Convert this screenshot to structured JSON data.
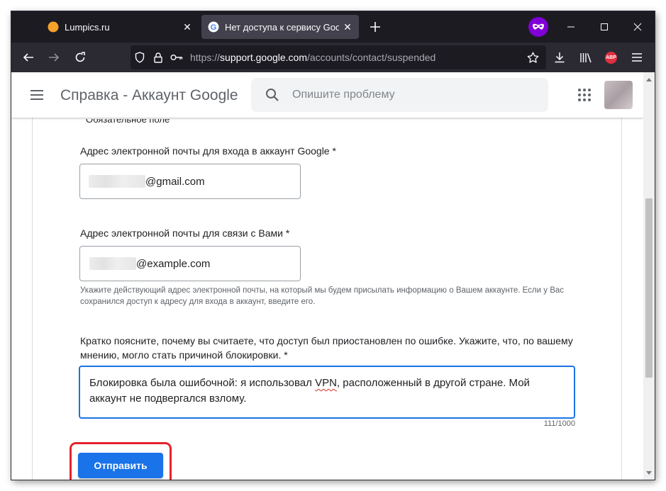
{
  "browser": {
    "tabs": [
      {
        "title": "Lumpics.ru",
        "active": false,
        "favicon": "orange-circle-icon"
      },
      {
        "title": "Нет доступа к сервису Google",
        "active": true,
        "favicon": "google-g-icon"
      }
    ],
    "new_tab_symbol": "+",
    "address_bar": {
      "scheme": "https://",
      "host": "support.google.com",
      "path": "/accounts/contact/suspended"
    },
    "extension_badge": "ABP"
  },
  "header": {
    "title": "Справка - Аккаунт Google",
    "search_placeholder": "Опишите проблему"
  },
  "form": {
    "cutoff_text": "Обязательное поле",
    "login_email": {
      "label": "Адрес электронной почты для входа в аккаунт Google *",
      "value_suffix": "@gmail.com"
    },
    "contact_email": {
      "label": "Адрес электронной почты для связи с Вами *",
      "value_suffix": "@example.com",
      "hint": "Укажите действующий адрес электронной почты, на который мы будем присылать информацию о Вашем аккаунте. Если у Вас сохранился доступ к адресу для входа в аккаунт, введите его."
    },
    "explanation": {
      "label": "Кратко поясните, почему вы считаете, что доступ был приостановлен по ошибке. Укажите, что, по вашему мнению, могло стать причиной блокировки. *",
      "text_before": "Блокировка была ошибочной: я использовал ",
      "text_misspelled": "VPN",
      "text_after": ", расположенный в другой стране. Мой аккаунт не подвергался взлому.",
      "counter": "111/1000"
    },
    "submit_label": "Отправить"
  },
  "colors": {
    "accent": "#1a73e8",
    "highlight": "#e4232d",
    "private_browsing": "#8000d7",
    "abp": "#e0303f"
  }
}
